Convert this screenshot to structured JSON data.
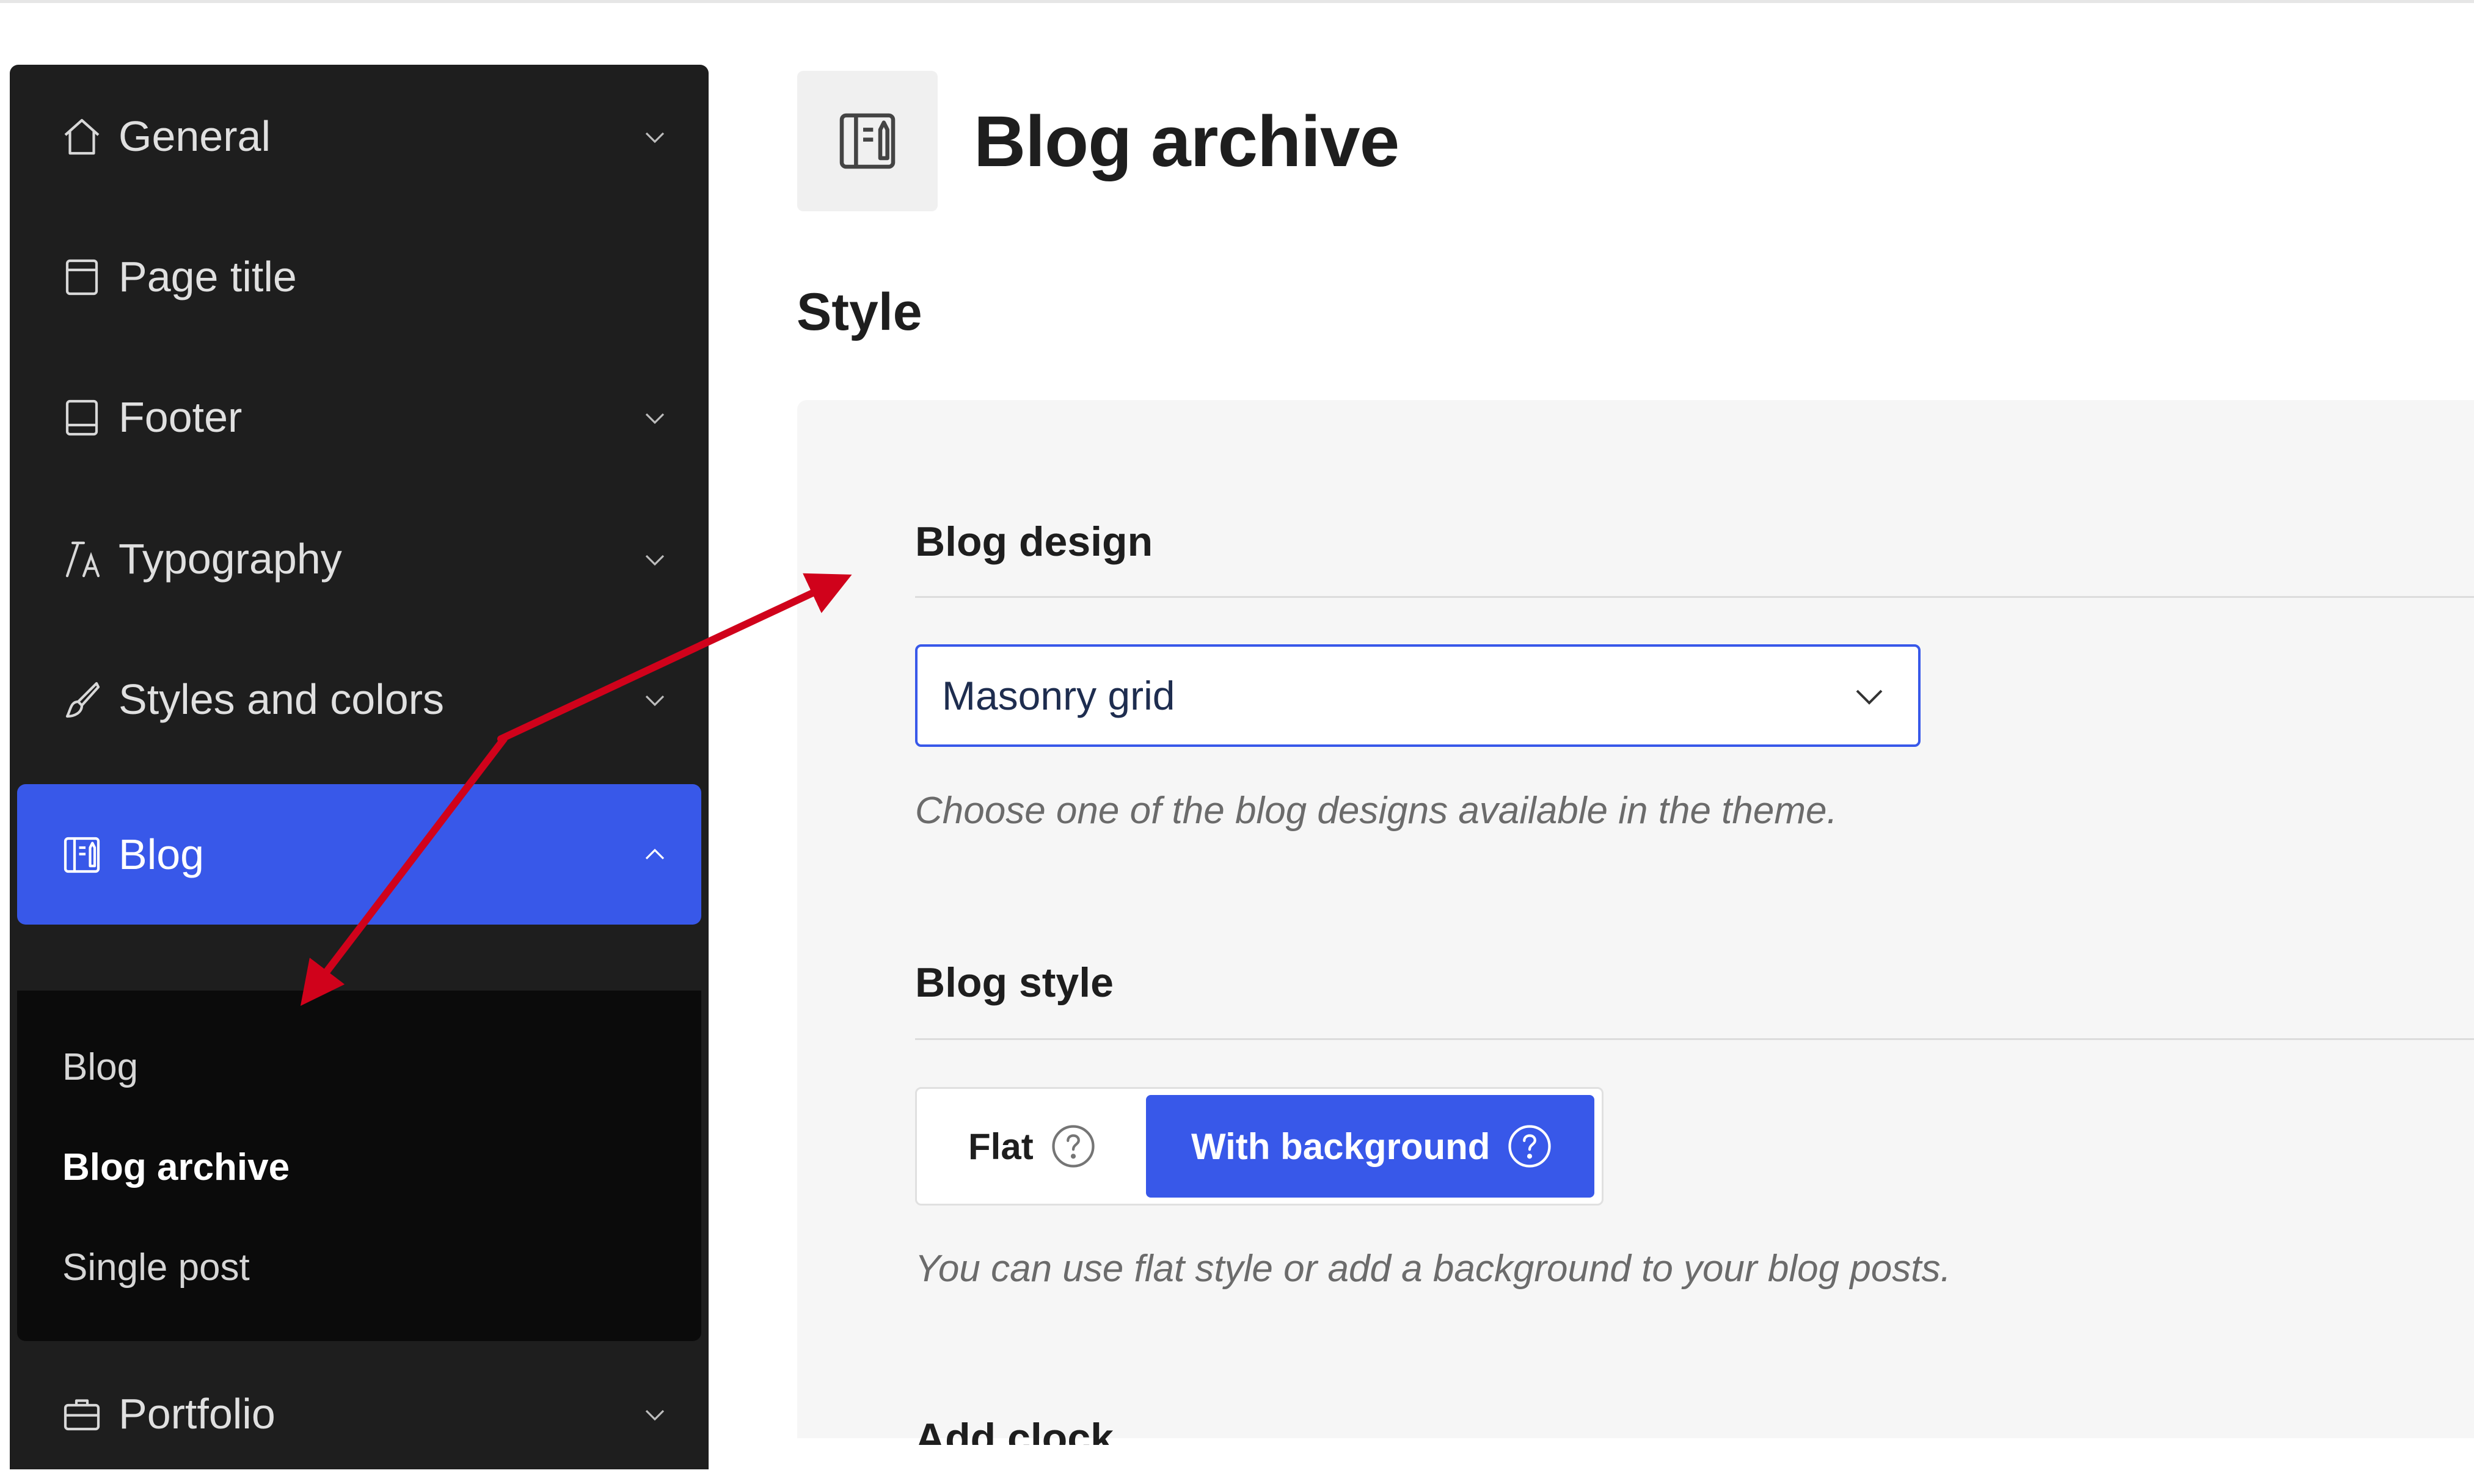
{
  "sidebar": {
    "items": [
      {
        "label": "General",
        "icon": "home-icon",
        "expanded": false
      },
      {
        "label": "Page title",
        "icon": "page-icon",
        "expanded": false
      },
      {
        "label": "Footer",
        "icon": "footer-icon",
        "expanded": false
      },
      {
        "label": "Typography",
        "icon": "typography-icon",
        "expanded": false
      },
      {
        "label": "Styles and colors",
        "icon": "brush-icon",
        "expanded": false
      },
      {
        "label": "Blog",
        "icon": "blog-icon",
        "expanded": true,
        "active": true
      },
      {
        "label": "Portfolio",
        "icon": "briefcase-icon",
        "expanded": false
      }
    ],
    "blog_submenu": [
      "Blog",
      "Blog archive",
      "Single post"
    ],
    "current_submenu": "Blog archive"
  },
  "page": {
    "title": "Blog archive",
    "section": "Style"
  },
  "blog_design": {
    "heading": "Blog design",
    "selected": "Masonry grid",
    "help": "Choose one of the blog designs available in the theme."
  },
  "blog_style": {
    "heading": "Blog style",
    "options": [
      "Flat",
      "With background"
    ],
    "selected": "With background",
    "help": "You can use flat style or add a background to your blog posts."
  },
  "next_heading": "Add clock",
  "colors": {
    "accent": "#3858e9",
    "sidebar": "#1e1e1e",
    "submenu": "#0b0b0b",
    "panel": "#f6f6f6",
    "annotation": "#d0021b"
  }
}
